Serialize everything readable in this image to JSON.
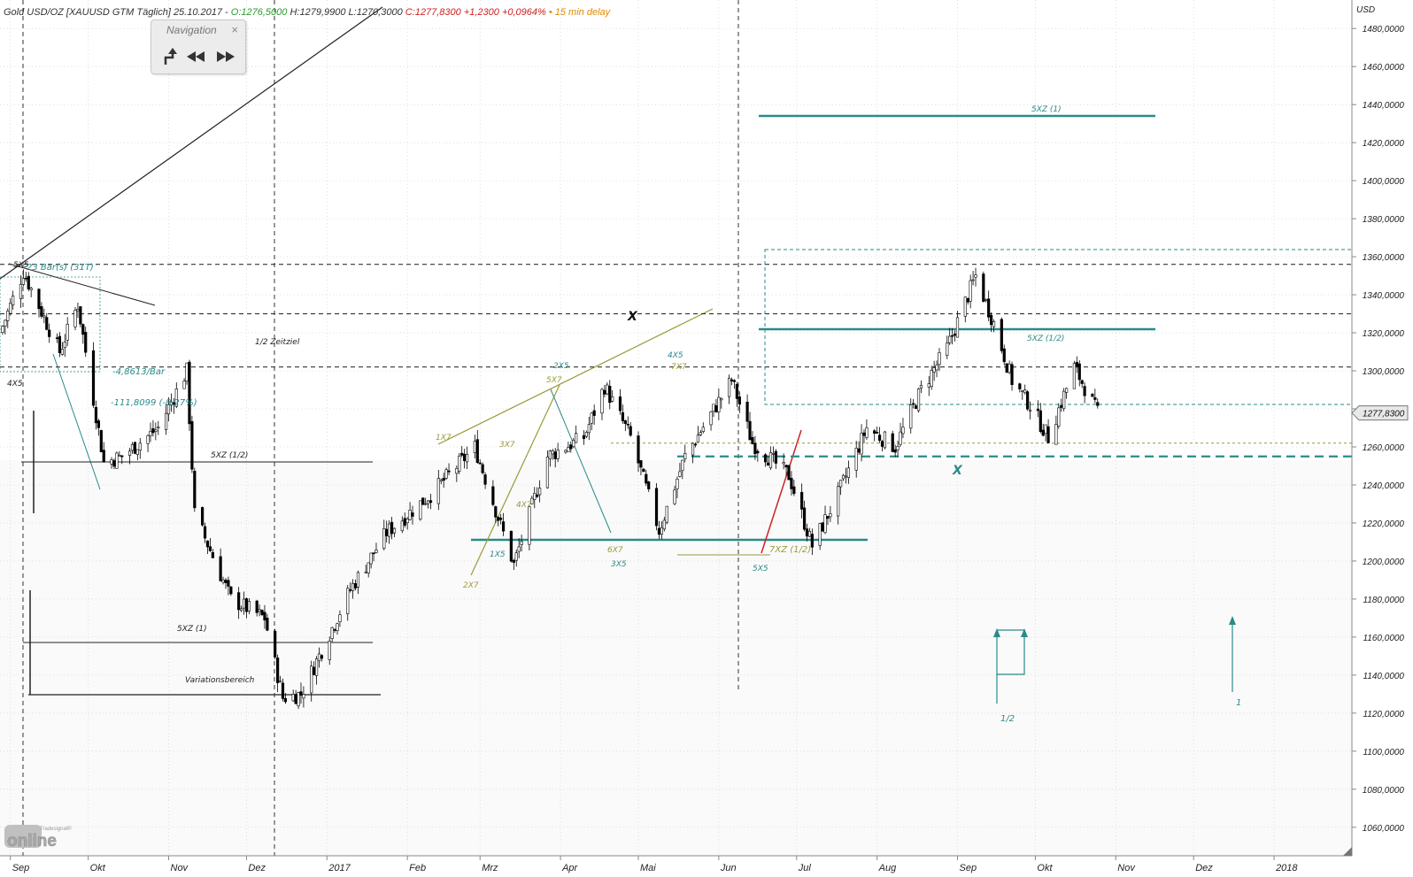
{
  "header": {
    "instrument": "Gold USD/OZ [XAUUSD GTM Täglich]",
    "date": "25.10.2017",
    "sep": " - ",
    "open": "O:1276,5000",
    "high": "H:1279,9900",
    "low": "L:1270,3000",
    "close_change": "C:1277,8300 +1,2300 +0,0964%",
    "delay": "• 15 min delay"
  },
  "navigation": {
    "title": "Navigation",
    "close": "×"
  },
  "logo": {
    "small": "Tradesignal®",
    "big": "online"
  },
  "colors": {
    "teal": "#2a8a8a",
    "olive": "#9a9a3a",
    "candle_up": "#ffffff",
    "candle_down": "#000000",
    "grid": "#d6d6d6",
    "red": "#cc2222"
  },
  "chart_data": {
    "type": "candlestick",
    "unit_label": "USD",
    "last_price_label": "1277,8300",
    "ylim": [
      1045,
      1495
    ],
    "y_ticks": [
      1060,
      1080,
      1100,
      1120,
      1140,
      1160,
      1180,
      1200,
      1220,
      1240,
      1260,
      1280,
      1300,
      1320,
      1340,
      1360,
      1380,
      1400,
      1420,
      1440,
      1460,
      1480
    ],
    "y_tick_labels": [
      "1060,0000",
      "1080,0000",
      "1100,0000",
      "1120,0000",
      "1140,0000",
      "1160,0000",
      "1180,0000",
      "1200,0000",
      "1220,0000",
      "1240,0000",
      "1260,0000",
      "1280,0000",
      "1300,0000",
      "1320,0000",
      "1340,0000",
      "1360,0000",
      "1380,0000",
      "1400,0000",
      "1420,0000",
      "1440,0000",
      "1460,0000",
      "1480,0000"
    ],
    "x_range": [
      "2016-08-28",
      "2018-01-31"
    ],
    "x_ticks": [
      {
        "date": "2016-09-01",
        "label": "Sep"
      },
      {
        "date": "2016-10-01",
        "label": "Okt"
      },
      {
        "date": "2016-11-01",
        "label": "Nov"
      },
      {
        "date": "2016-12-01",
        "label": "Dez"
      },
      {
        "date": "2017-01-01",
        "label": "2017"
      },
      {
        "date": "2017-02-01",
        "label": "Feb"
      },
      {
        "date": "2017-03-01",
        "label": "Mrz"
      },
      {
        "date": "2017-04-01",
        "label": "Apr"
      },
      {
        "date": "2017-05-01",
        "label": "Mai"
      },
      {
        "date": "2017-06-01",
        "label": "Jun"
      },
      {
        "date": "2017-07-01",
        "label": "Jul"
      },
      {
        "date": "2017-08-01",
        "label": "Aug"
      },
      {
        "date": "2017-09-01",
        "label": "Sep"
      },
      {
        "date": "2017-10-01",
        "label": "Okt"
      },
      {
        "date": "2017-11-01",
        "label": "Nov"
      },
      {
        "date": "2017-12-01",
        "label": "Dez"
      },
      {
        "date": "2018-01-01",
        "label": "2018"
      }
    ],
    "price_path": [
      [
        "2016-08-28",
        1320
      ],
      [
        "2016-09-06",
        1352
      ],
      [
        "2016-09-20",
        1310
      ],
      [
        "2016-09-27",
        1335
      ],
      [
        "2016-10-07",
        1252
      ],
      [
        "2016-10-14",
        1255
      ],
      [
        "2016-10-28",
        1270
      ],
      [
        "2016-11-08",
        1300
      ],
      [
        "2016-11-11",
        1225
      ],
      [
        "2016-11-25",
        1180
      ],
      [
        "2016-12-08",
        1170
      ],
      [
        "2016-12-15",
        1128
      ],
      [
        "2016-12-22",
        1130
      ],
      [
        "2017-01-10",
        1185
      ],
      [
        "2017-01-24",
        1215
      ],
      [
        "2017-02-10",
        1235
      ],
      [
        "2017-02-27",
        1260
      ],
      [
        "2017-03-14",
        1198
      ],
      [
        "2017-03-27",
        1255
      ],
      [
        "2017-04-10",
        1265
      ],
      [
        "2017-04-18",
        1292
      ],
      [
        "2017-04-28",
        1265
      ],
      [
        "2017-05-09",
        1216
      ],
      [
        "2017-05-19",
        1255
      ],
      [
        "2017-06-06",
        1295
      ],
      [
        "2017-06-14",
        1262
      ],
      [
        "2017-06-28",
        1245
      ],
      [
        "2017-07-07",
        1208
      ],
      [
        "2017-07-17",
        1235
      ],
      [
        "2017-07-28",
        1270
      ],
      [
        "2017-08-08",
        1260
      ],
      [
        "2017-08-18",
        1290
      ],
      [
        "2017-08-28",
        1312
      ],
      [
        "2017-09-08",
        1350
      ],
      [
        "2017-09-15",
        1325
      ],
      [
        "2017-09-22",
        1295
      ],
      [
        "2017-09-29",
        1282
      ],
      [
        "2017-10-06",
        1265
      ],
      [
        "2017-10-16",
        1302
      ],
      [
        "2017-10-25",
        1277.83
      ]
    ],
    "horizontal_levels": [
      {
        "value": 1356,
        "style": "dashed",
        "color": "#333333"
      },
      {
        "value": 1330,
        "style": "dashed",
        "color": "#333333"
      },
      {
        "value": 1302,
        "style": "dashed",
        "color": "#333333"
      },
      {
        "value": 1262,
        "style": "dotted",
        "color": "#9a9a3a"
      },
      {
        "value": 1255,
        "style": "dashed-bold",
        "color": "#2a8a8a"
      }
    ],
    "annotations": [
      "5X5",
      "4X5",
      "23 Bar(s) (31T)",
      "-4,8613/Bar",
      "-111,8099 (-8,27%)",
      "1/2 Zeitziel",
      "5XZ (1/2)",
      "5XZ (1)",
      "Variationsbereich",
      "1X7",
      "2X5",
      "5X7",
      "3X7",
      "4X7",
      "1X5",
      "2X7",
      "6X7",
      "3X5",
      "4X5",
      "7X7",
      "X",
      "X",
      "5X5",
      "7XZ (1/2)",
      "5XZ (1)",
      "5XZ (1/2)",
      "1/2",
      "1"
    ]
  }
}
